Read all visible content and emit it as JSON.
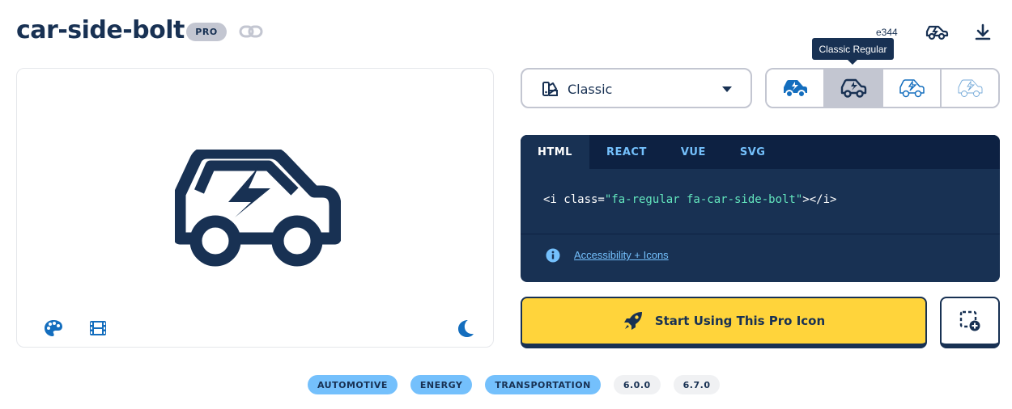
{
  "icon": {
    "name": "car-side-bolt",
    "badge": "PRO",
    "unicode": "e344"
  },
  "style_select": {
    "value": "Classic"
  },
  "variants": [
    {
      "label": "Solid",
      "active": false
    },
    {
      "label": "Regular",
      "active": true
    },
    {
      "label": "Light",
      "active": false
    },
    {
      "label": "Thin",
      "active": false
    }
  ],
  "tooltip": "Classic Regular",
  "code": {
    "tabs": [
      "HTML",
      "REACT",
      "VUE",
      "SVG"
    ],
    "active_tab": "HTML",
    "snippet_prefix": "<i class=",
    "snippet_value": "\"fa-regular fa-car-side-bolt\"",
    "snippet_suffix": "></i>",
    "accessibility_link": "Accessibility + Icons"
  },
  "start_button": "Start Using This Pro Icon",
  "tags": {
    "categories": [
      "AUTOMOTIVE",
      "ENERGY",
      "TRANSPORTATION"
    ],
    "versions": [
      "6.0.0",
      "6.7.0"
    ]
  },
  "colors": {
    "navy": "#183153",
    "accent_blue": "#74c0fc",
    "yellow": "#ffd43b",
    "gray": "#c3c6d1",
    "icon_blue": "#146ebe"
  },
  "icons": [
    "link-icon",
    "car-side-bolt-icon",
    "download-icon",
    "palette-icon",
    "film-icon",
    "moon-icon",
    "style-icon",
    "caret-down-icon",
    "info-icon",
    "rocket-icon",
    "add-to-kit-icon"
  ]
}
